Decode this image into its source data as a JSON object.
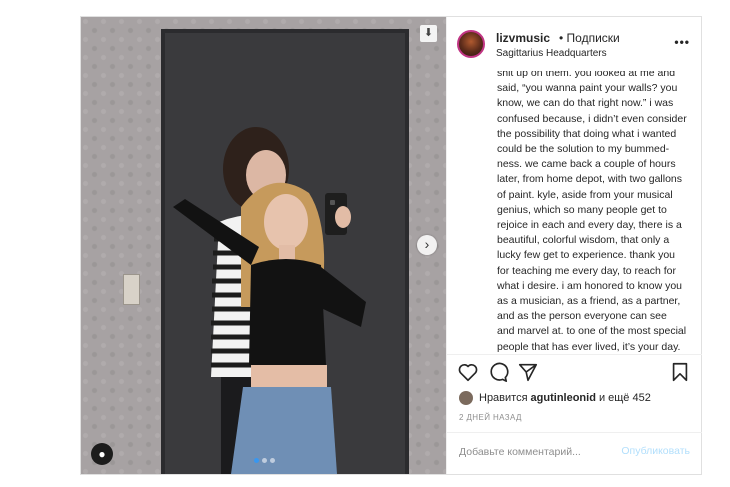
{
  "header": {
    "username": "lizvmusic",
    "follow_label": "• Подписки",
    "location": "Sagittarius Headquarters"
  },
  "caption": "shit up on them.  you looked at me and said, “you wanna paint your walls? you know, we can do that right now.” i was confused because, i didn’t even consider the possibility that doing what i wanted could be the solution to my bummed-ness. we came back a couple of hours later, from home depot, with two gallons of paint. kyle, aside from your musical genius, which so many people get to rejoice in each and every day, there is a beautiful, colorful wisdom, that only a lucky few get to experience. thank you for teaching me every day, to reach for what i desire. i am honored to know you as a musician, as a friend, as a partner, and as the person everyone can see and marvel at. to one of the most special people that has ever lived, it’s your day.",
  "likes": {
    "prefix": "Нравится",
    "user": "agutinleonid",
    "suffix": "и ещё 452"
  },
  "timestamp": "2 ДНЕЙ НАЗАД",
  "comment": {
    "placeholder": "Добавьте комментарий...",
    "value": "",
    "publish_label": "Опубликовать"
  },
  "carousel": {
    "total": 3,
    "active_index": 0
  },
  "icons": {
    "more": "more-options-icon",
    "like": "heart-icon",
    "comment": "comment-icon",
    "share": "share-icon",
    "save": "bookmark-icon",
    "download": "download-icon",
    "next": "chevron-right-icon",
    "tagged": "user-tag-icon"
  },
  "colors": {
    "link_disabled": "#b2dffc",
    "story_ring": "#c13584",
    "carousel_active": "#3897f0"
  }
}
